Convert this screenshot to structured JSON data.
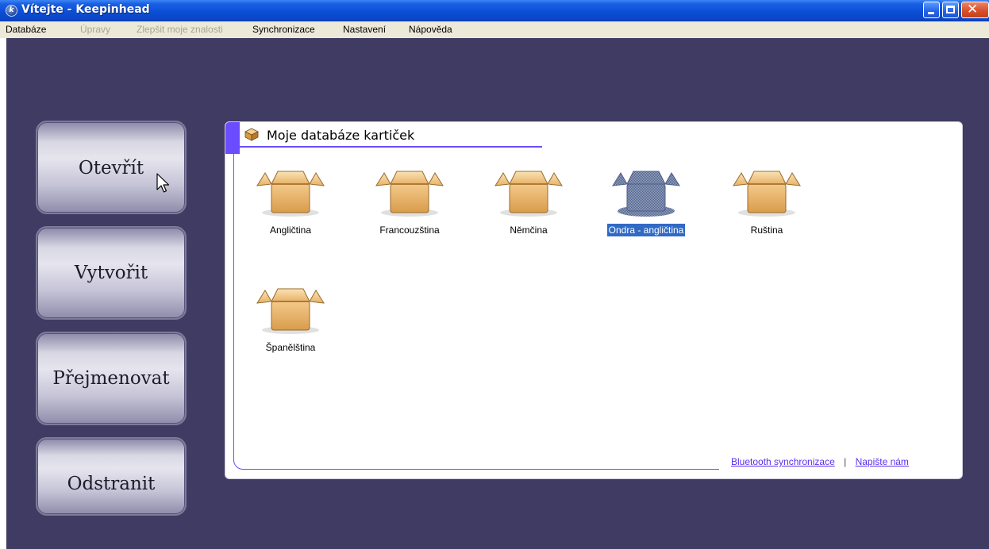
{
  "window": {
    "title": "Vítejte - Keepinhead",
    "icon_letter": "k",
    "close_glyph": "✕"
  },
  "menu": {
    "items": [
      {
        "label": "Databáze",
        "enabled": true
      },
      {
        "label": "Úpravy",
        "enabled": false
      },
      {
        "label": "Zlepšit moje znalosti",
        "enabled": false
      },
      {
        "label": "Synchronizace",
        "enabled": true
      },
      {
        "label": "Nastavení",
        "enabled": true
      },
      {
        "label": "Nápověda",
        "enabled": true
      }
    ]
  },
  "sidebar": {
    "buttons": [
      {
        "label": "Otevřít"
      },
      {
        "label": "Vytvořit"
      },
      {
        "label": "Přejmenovat"
      },
      {
        "label": "Odstranit"
      }
    ]
  },
  "panel": {
    "title": "Moje databáze kartiček",
    "databases": [
      {
        "label": "Angličtina",
        "selected": false
      },
      {
        "label": "Francouzština",
        "selected": false
      },
      {
        "label": "Němčina",
        "selected": false
      },
      {
        "label": "Ondra - angličtina",
        "selected": true
      },
      {
        "label": "Ruština",
        "selected": false
      },
      {
        "label": "Španělština",
        "selected": false
      }
    ],
    "links": {
      "bluetooth": "Bluetooth synchronizace",
      "separator": "|",
      "contact": "Napište nám"
    }
  },
  "colors": {
    "background": "#3f3b62",
    "accent": "#6c4cff",
    "selection": "#316ac5",
    "box": "#e9b46a"
  }
}
